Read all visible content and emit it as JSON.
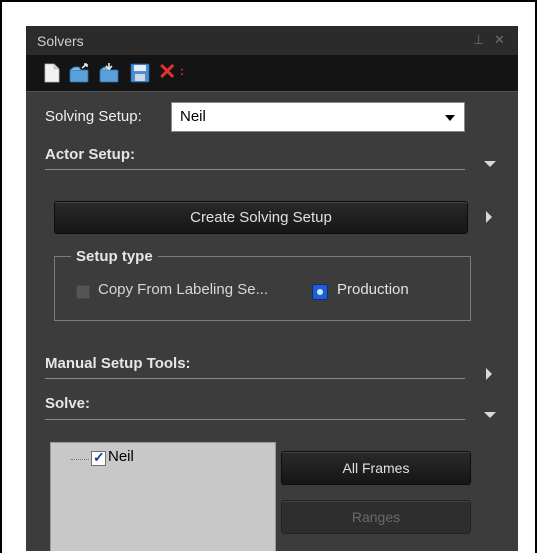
{
  "panel": {
    "title": "Solvers",
    "pin_glyph": "⊥",
    "close_glyph": "✕"
  },
  "toolbar": {
    "icons": [
      "new-file-icon",
      "open-folder-icon",
      "import-folder-icon",
      "save-icon",
      "delete-icon"
    ],
    "delete_glyph": "✕"
  },
  "solving_setup": {
    "label": "Solving Setup:",
    "value": "Neil"
  },
  "actor_setup": {
    "header": "Actor Setup:",
    "create_button": "Create Solving Setup",
    "setup_type": {
      "legend": "Setup type",
      "option_copy": "Copy From Labeling Se...",
      "option_production": "Production",
      "selected": "Production"
    }
  },
  "manual_setup": {
    "header": "Manual Setup Tools:"
  },
  "solve": {
    "header": "Solve:",
    "tree_items": [
      {
        "label": "Neil",
        "checked": true
      }
    ],
    "all_frames_button": "All Frames",
    "ranges_button": "Ranges"
  }
}
